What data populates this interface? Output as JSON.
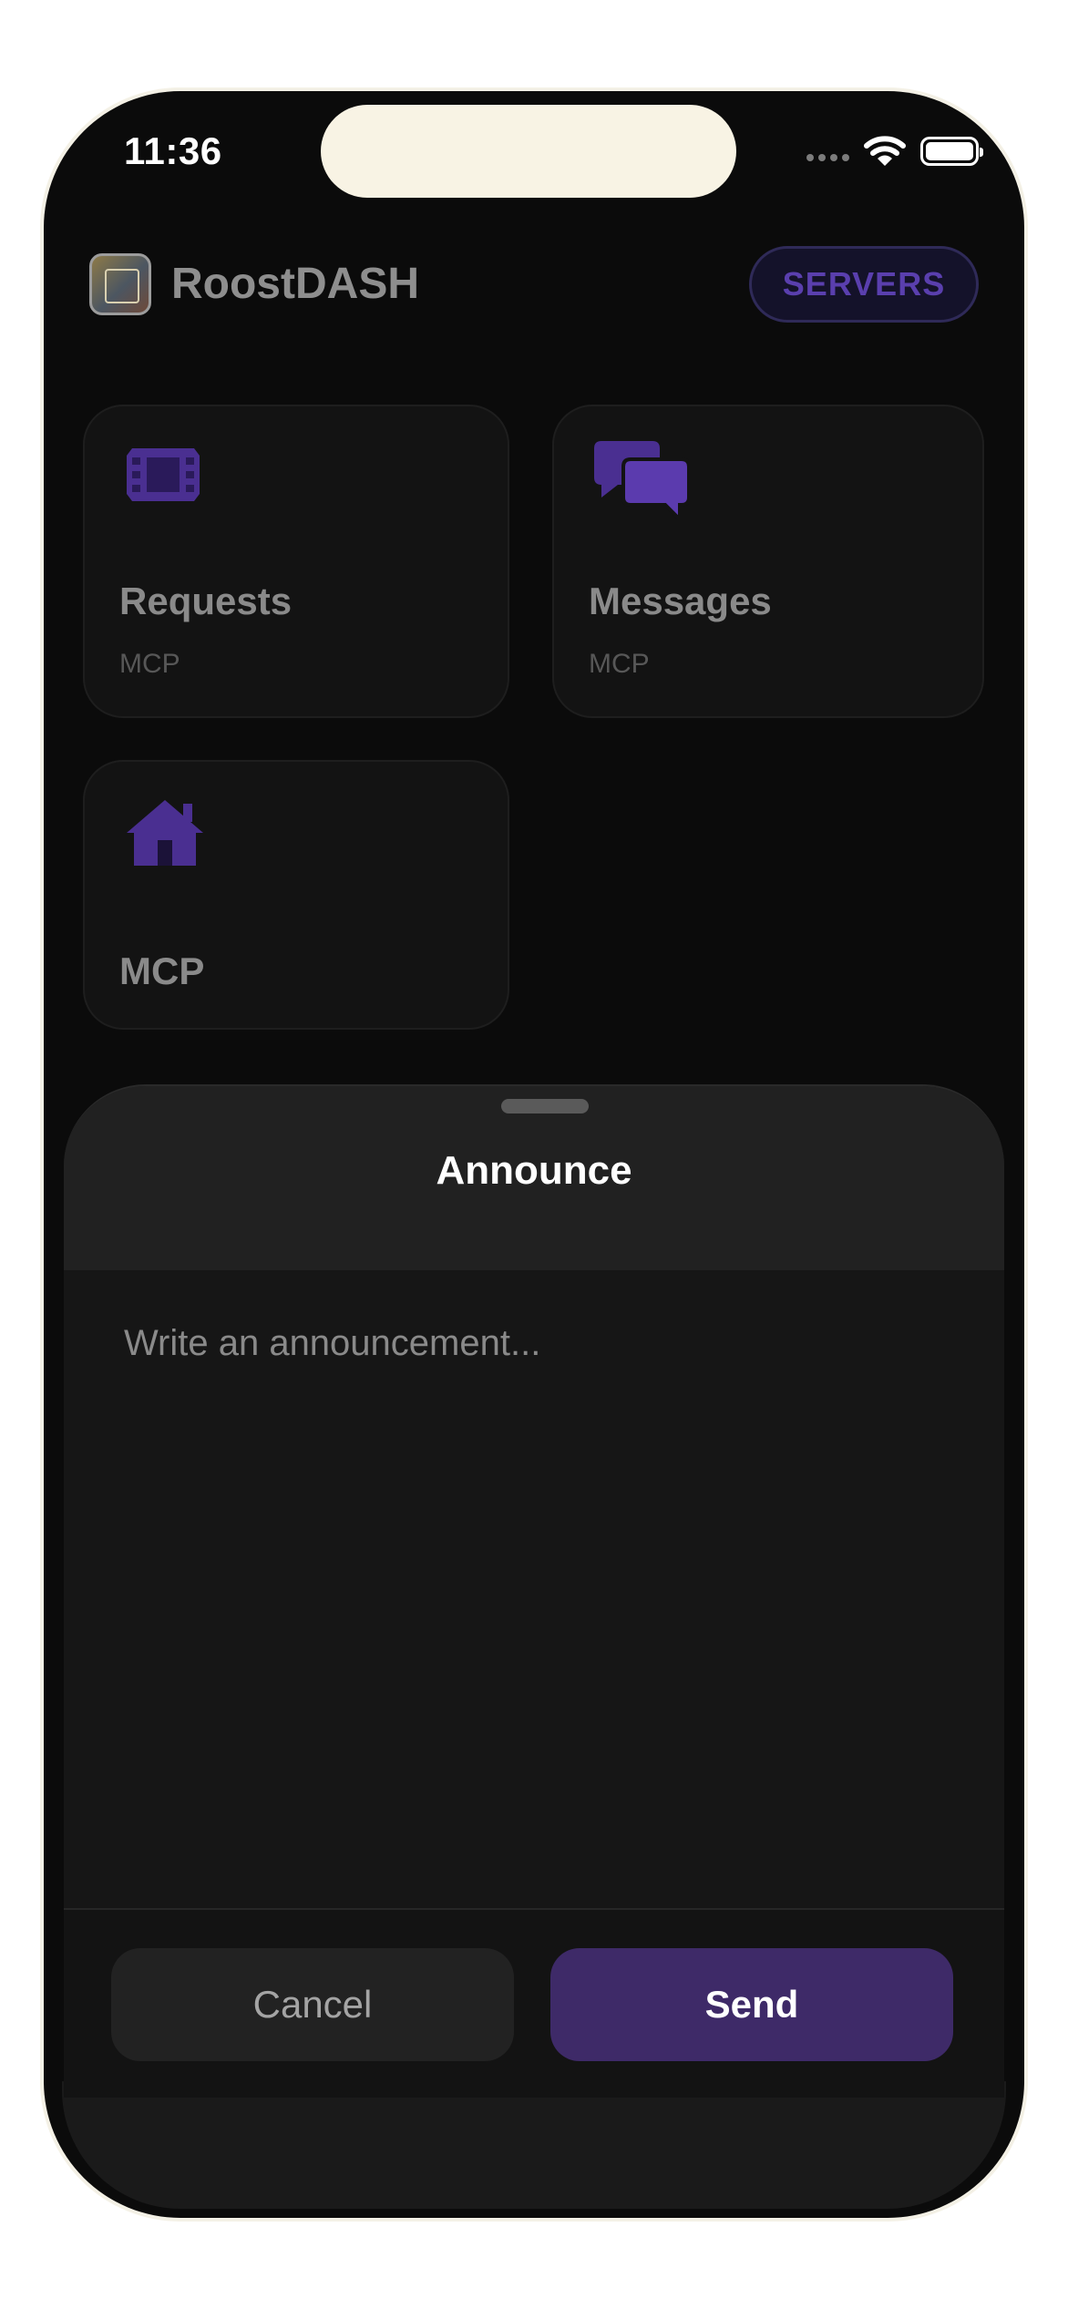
{
  "status_bar": {
    "time": "11:36"
  },
  "header": {
    "app_name": "RoostDASH",
    "servers_button": "SERVERS"
  },
  "cards": [
    {
      "title": "Requests",
      "subtitle": "MCP",
      "icon": "film-icon"
    },
    {
      "title": "Messages",
      "subtitle": "MCP",
      "icon": "chat-bubbles-icon"
    },
    {
      "title": "MCP",
      "subtitle": "",
      "icon": "home-icon"
    }
  ],
  "sheet": {
    "title": "Announce",
    "input_placeholder": "Write an announcement...",
    "input_value": "",
    "cancel_label": "Cancel",
    "send_label": "Send"
  },
  "colors": {
    "accent": "#5a3fae",
    "send_button": "#3e2a68",
    "background": "#0b0b0b"
  }
}
